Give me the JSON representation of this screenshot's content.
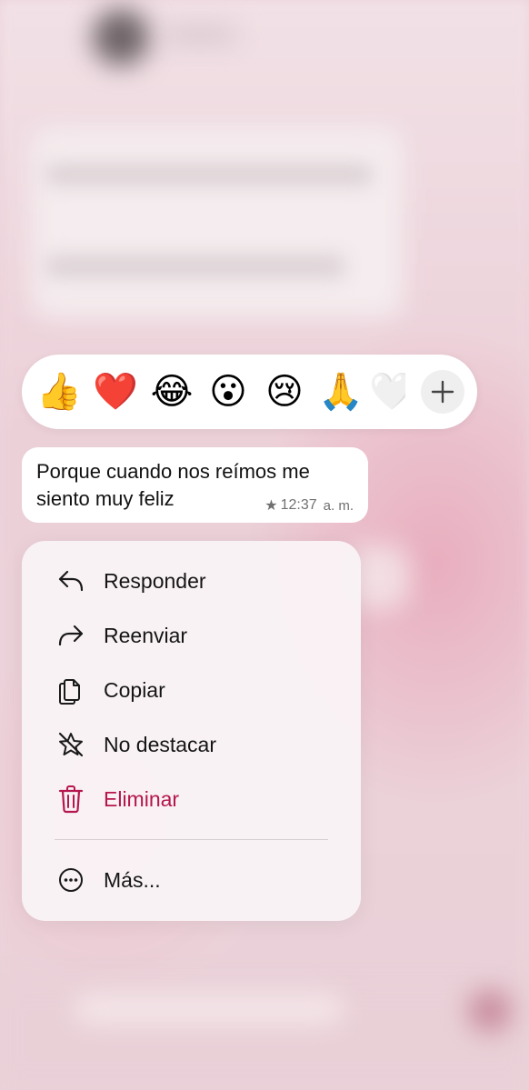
{
  "reactions": {
    "emojis": [
      "👍",
      "❤️",
      "😂",
      "😮",
      "😢",
      "🙏",
      "🤍"
    ],
    "more_label": "+"
  },
  "message": {
    "text": "Porque cuando nos reímos me siento muy feliz",
    "star": "★",
    "time": "12:37",
    "time_suffix": "a. m."
  },
  "menu": {
    "reply": "Responder",
    "forward": "Reenviar",
    "copy": "Copiar",
    "unstar": "No destacar",
    "delete": "Eliminar",
    "more": "Más..."
  },
  "colors": {
    "danger": "#b5164d",
    "background_tint": "#ecd3db"
  }
}
